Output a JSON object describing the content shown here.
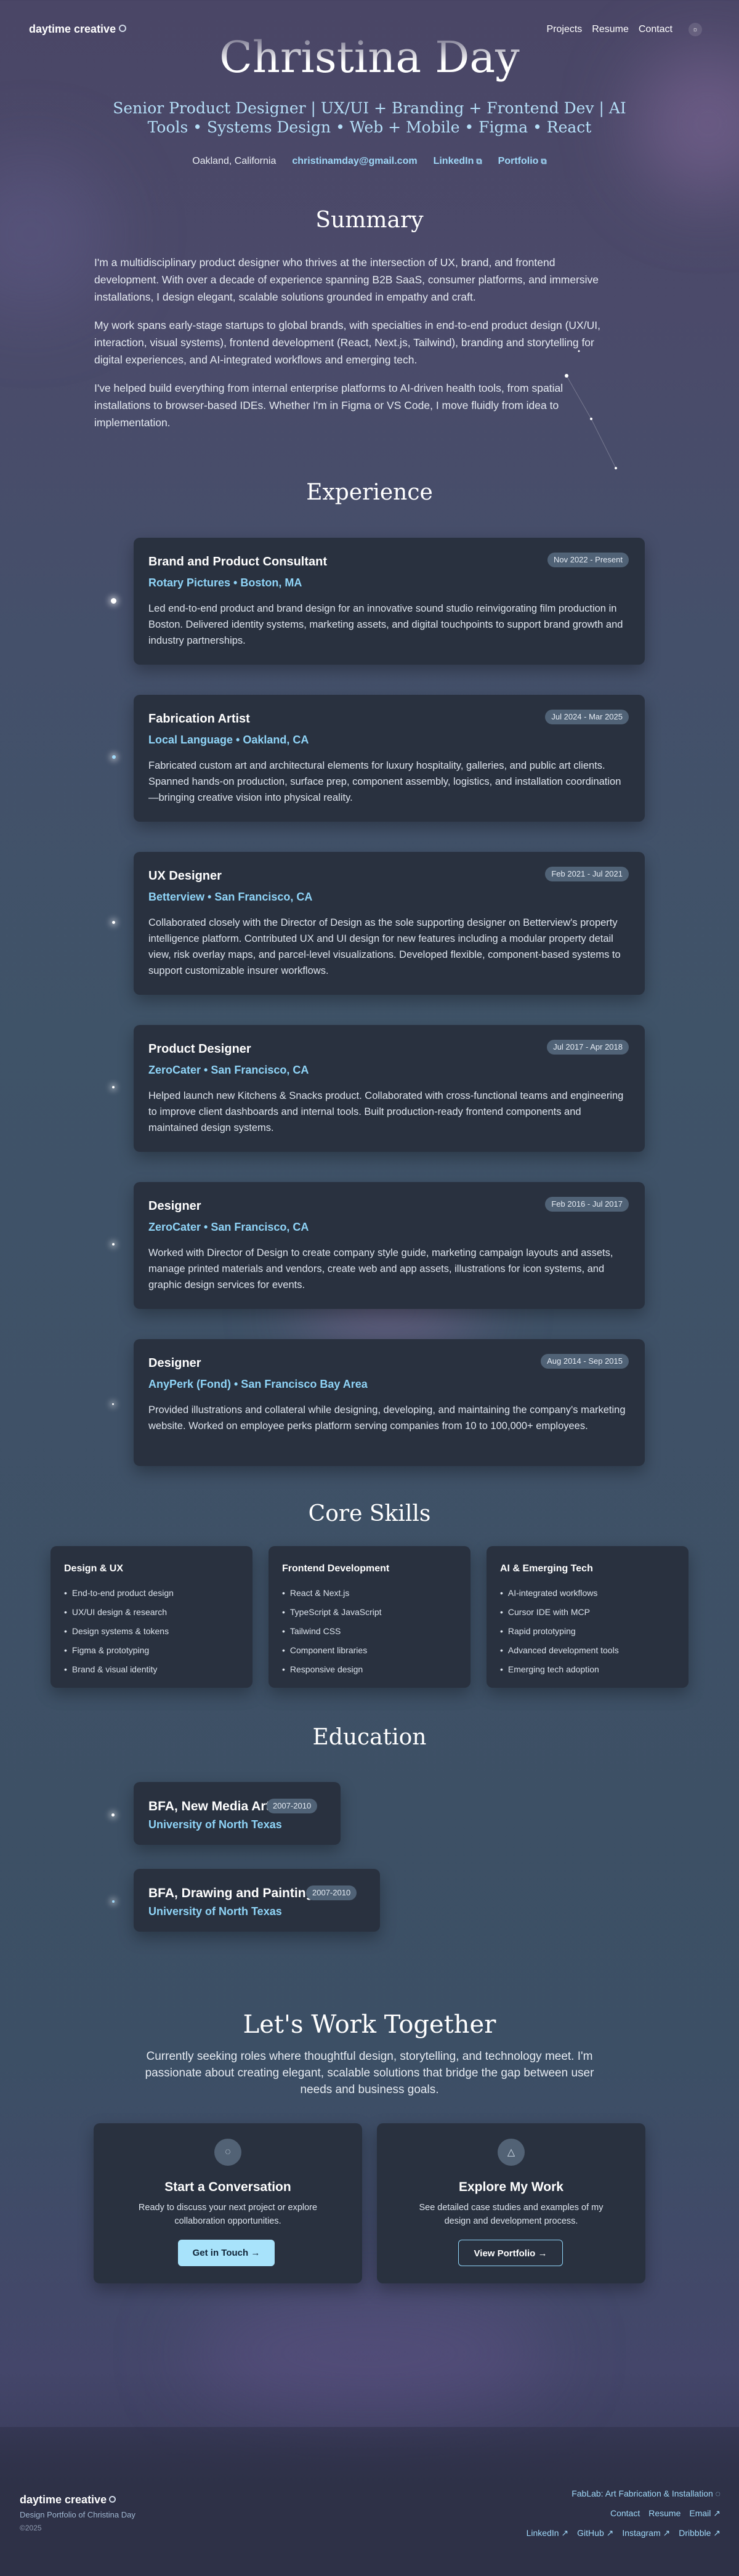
{
  "nav": {
    "logo": "daytime creative",
    "links": [
      "Projects",
      "Resume",
      "Contact"
    ],
    "theme_icon": "☼"
  },
  "hero": {
    "name": "Christina Day",
    "subtitle": "Senior Product Designer | UX/UI + Branding + Frontend Dev | AI Tools • Systems Design • Web + Mobile • Figma • React",
    "location": "Oakland, California",
    "email": "christinamday@gmail.com",
    "linkedin": "LinkedIn",
    "portfolio": "Portfolio"
  },
  "summary": {
    "title": "Summary",
    "paragraphs": [
      "I'm a multidisciplinary product designer who thrives at the intersection of UX, brand, and frontend development. With over a decade of experience spanning B2B SaaS, consumer platforms, and immersive installations, I design elegant, scalable solutions grounded in empathy and craft.",
      "My work spans early-stage startups to global brands, with specialties in end-to-end product design (UX/UI, interaction, visual systems), frontend development (React, Next.js, Tailwind), branding and storytelling for digital experiences, and AI-integrated workflows and emerging tech.",
      "I've helped build everything from internal enterprise platforms to AI-driven health tools, from spatial installations to browser-based IDEs. Whether I'm in Figma or VS Code, I move fluidly from idea to implementation."
    ]
  },
  "experience": {
    "title": "Experience",
    "items": [
      {
        "title": "Brand and Product Consultant",
        "company": "Rotary Pictures • Boston, MA",
        "dates": "Nov 2022 - Present",
        "desc": "Led end-to-end product and brand design for an innovative sound studio reinvigorating film production in Boston. Delivered identity systems, marketing assets, and digital touchpoints to support brand growth and industry partnerships."
      },
      {
        "title": "Fabrication Artist",
        "company": "Local Language • Oakland, CA",
        "dates": "Jul 2024 - Mar 2025",
        "desc": "Fabricated custom art and architectural elements for luxury hospitality, galleries, and public art clients. Spanned hands-on production, surface prep, component assembly, logistics, and installation coordination—bringing creative vision into physical reality."
      },
      {
        "title": "UX Designer",
        "company": "Betterview • San Francisco, CA",
        "dates": "Feb 2021 - Jul 2021",
        "desc": "Collaborated closely with the Director of Design as the sole supporting designer on Betterview's property intelligence platform. Contributed UX and UI design for new features including a modular property detail view, risk overlay maps, and parcel-level visualizations. Developed flexible, component-based systems to support customizable insurer workflows."
      },
      {
        "title": "Product Designer",
        "company": "ZeroCater • San Francisco, CA",
        "dates": "Jul 2017 - Apr 2018",
        "desc": "Helped launch new Kitchens & Snacks product. Collaborated with cross-functional teams and engineering to improve client dashboards and internal tools. Built production-ready frontend components and maintained design systems."
      },
      {
        "title": "Designer",
        "company": "ZeroCater • San Francisco, CA",
        "dates": "Feb 2016 - Jul 2017",
        "desc": "Worked with Director of Design to create company style guide, marketing campaign layouts and assets, manage printed materials and vendors, create web and app assets, illustrations for icon systems, and graphic design services for events."
      },
      {
        "title": "Designer",
        "company": "AnyPerk (Fond) • San Francisco Bay Area",
        "dates": "Aug 2014 - Sep 2015",
        "desc": "Provided illustrations and collateral while designing, developing, and maintaining the company's marketing website. Worked on employee perks platform serving companies from 10 to 100,000+ employees."
      }
    ]
  },
  "skills": {
    "title": "Core Skills",
    "groups": [
      {
        "name": "Design & UX",
        "items": [
          "End-to-end product design",
          "UX/UI design & research",
          "Design systems & tokens",
          "Figma & prototyping",
          "Brand & visual identity"
        ]
      },
      {
        "name": "Frontend Development",
        "items": [
          "React & Next.js",
          "TypeScript & JavaScript",
          "Tailwind CSS",
          "Component libraries",
          "Responsive design"
        ]
      },
      {
        "name": "AI & Emerging Tech",
        "items": [
          "AI-integrated workflows",
          "Cursor IDE with MCP",
          "Rapid prototyping",
          "Advanced development tools",
          "Emerging tech adoption"
        ]
      }
    ]
  },
  "education": {
    "title": "Education",
    "items": [
      {
        "degree": "BFA, New Media Art",
        "years": "2007-2010",
        "school": "University of North Texas"
      },
      {
        "degree": "BFA, Drawing and Painting",
        "years": "2007-2010",
        "school": "University of North Texas"
      }
    ]
  },
  "cta": {
    "title": "Let's Work Together",
    "text": "Currently seeking roles where thoughtful design, storytelling, and technology meet. I'm passionate about creating elegant, scalable solutions that bridge the gap between user needs and business goals.",
    "cards": [
      {
        "icon": "chat-icon",
        "title": "Start a Conversation",
        "desc": "Ready to discuss your next project or explore collaboration opportunities.",
        "button": "Get in Touch"
      },
      {
        "icon": "triangle-icon",
        "title": "Explore My Work",
        "desc": "See detailed case studies and examples of my design and development process.",
        "button": "View Portfolio"
      }
    ]
  },
  "footer": {
    "logo": "daytime creative",
    "subtitle": "Design Portfolio of Christina Day",
    "copyright": "©2025",
    "fablab": "FabLab: Art Fabrication & Installation",
    "nav": [
      "Contact",
      "Resume",
      "Email"
    ],
    "social": [
      "LinkedIn",
      "GitHub",
      "Instagram",
      "Dribbble"
    ]
  },
  "colors": {
    "accent": "#8fd4f7",
    "card": "#29313f",
    "badge": "#506276",
    "button": "#a8e3fb"
  }
}
